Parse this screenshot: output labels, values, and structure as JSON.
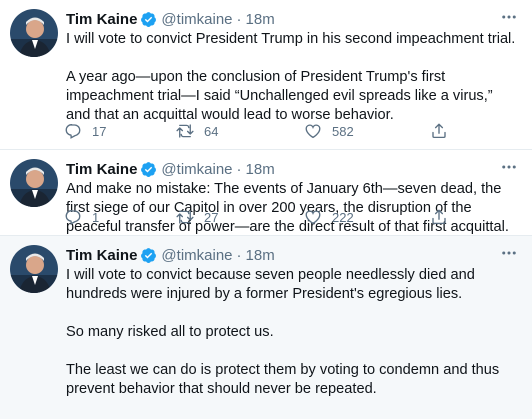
{
  "tweets": [
    {
      "name": "Tim Kaine",
      "handle": "@timkaine",
      "time": "18m",
      "paragraphs": [
        "I will vote to convict President Trump in his second impeachment trial.",
        "A year ago—upon the conclusion of President Trump's first impeachment trial—I said “Unchallenged evil spreads like a virus,” and that an acquittal would lead to worse behavior."
      ],
      "replies": "17",
      "retweets": "64",
      "likes": "582"
    },
    {
      "name": "Tim Kaine",
      "handle": "@timkaine",
      "time": "18m",
      "paragraphs": [
        "And make no mistake: The events of January 6th—seven dead, the first siege of our Capitol in over 200 years, the disruption of the peaceful transfer of power—are the direct result of that first acquittal."
      ],
      "replies": "1",
      "retweets": "27",
      "likes": "222"
    },
    {
      "name": "Tim Kaine",
      "handle": "@timkaine",
      "time": "18m",
      "paragraphs": [
        "I will vote to convict because seven people needlessly died and hundreds were injured by a former President's egregious lies.",
        "So many risked all to protect us.",
        "The least we can do is protect them by voting to condemn and thus prevent behavior that should never be repeated."
      ]
    }
  ],
  "separator": "·",
  "colors": {
    "verified": "#1da1f2",
    "secondary_text": "#5b7083",
    "highlight_background": "#f5f8fa",
    "divider": "#e6ecf0"
  },
  "icons": [
    "avatar",
    "verified-badge-icon",
    "more-icon",
    "reply-icon",
    "retweet-icon",
    "like-icon",
    "share-icon"
  ]
}
